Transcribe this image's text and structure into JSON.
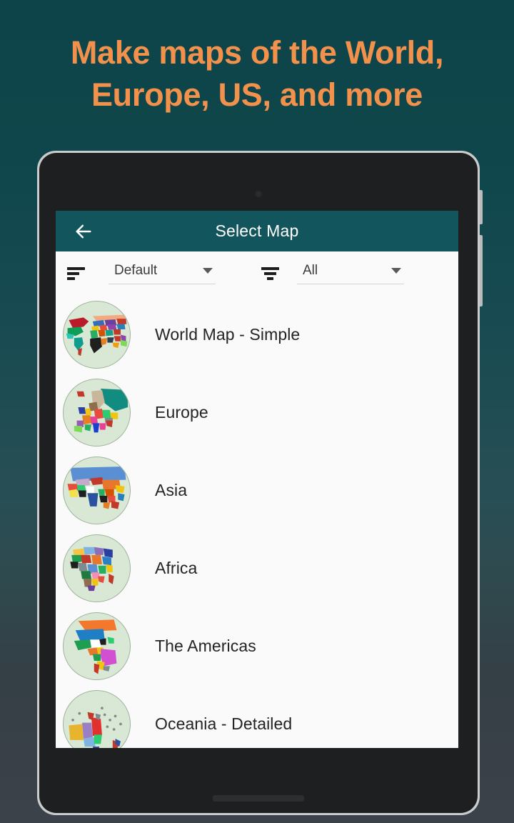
{
  "promo": {
    "headline": "Make maps of the World,\nEurope, US, and more",
    "headline_color": "#f2914b",
    "background_top_color": "#0d4449",
    "background_bottom_color": "#3c4249"
  },
  "app": {
    "appbar": {
      "back_icon": "back-arrow-icon",
      "title": "Select Map",
      "background_color": "#12555c",
      "title_color": "#ffffff"
    },
    "controls": {
      "sort": {
        "icon": "sort-icon",
        "value": "Default",
        "caret_icon": "chevron-down-icon"
      },
      "filter": {
        "icon": "filter-icon",
        "value": "All",
        "caret_icon": "chevron-down-icon"
      }
    },
    "map_list": {
      "items": [
        {
          "name": "World Map - Simple",
          "thumbnail": "world-map-thumbnail"
        },
        {
          "name": "Europe",
          "thumbnail": "europe-map-thumbnail"
        },
        {
          "name": "Asia",
          "thumbnail": "asia-map-thumbnail"
        },
        {
          "name": "Africa",
          "thumbnail": "africa-map-thumbnail"
        },
        {
          "name": "The Americas",
          "thumbnail": "americas-map-thumbnail"
        },
        {
          "name": "Oceania - Detailed",
          "thumbnail": "oceania-map-thumbnail"
        }
      ]
    }
  },
  "device": {
    "camera_icon": "front-camera-icon",
    "home_indicator": "home-indicator",
    "side_buttons": [
      "volume-button",
      "power-button"
    ]
  }
}
